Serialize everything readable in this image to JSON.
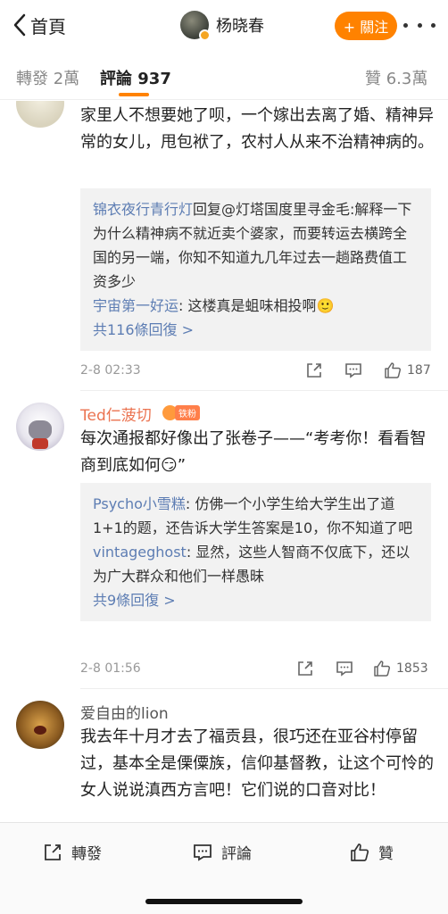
{
  "nav": {
    "back_label": "首頁",
    "user_name": "杨晓春",
    "follow_label": "+ 關注"
  },
  "tabs": [
    {
      "label": "轉發 2萬"
    },
    {
      "label": "評論 937"
    },
    {
      "label": "贊 6.3萬"
    }
  ],
  "comments": [
    {
      "user": "",
      "text": "家里人不想要她了呗，一个嫁出去离了婚、精神异常的女儿，甩包袱了，农村人从来不治精神病的。",
      "replies": [
        {
          "user": "锦衣夜行青行灯",
          "text": "回复@灯塔国度里寻金毛:解释一下为什么精神病不就近卖个婆家，而要转运去横跨全国的另一端，你知不知道九几年过去一趟路费值工资多少"
        },
        {
          "user": "宇宙第一好运",
          "text": ": 这楼真是蛆味相投啊🙂"
        }
      ],
      "more_replies": "共116條回復 >",
      "time": "2-8 02:33",
      "likes": "187"
    },
    {
      "user": "Ted仁菠切",
      "badge": "铁粉",
      "text": "每次通报都好像出了张卷子——“考考你！看看智商到底如何😏”",
      "replies": [
        {
          "user": "Psycho小雪糕",
          "text": ": 仿佛一个小学生给大学生出了道1+1的题，还告诉大学生答案是10，你不知道了吧"
        },
        {
          "user": "vintageghost",
          "text": ": 显然，这些人智商不仅底下，还以为广大群众和他们一样愚昧"
        }
      ],
      "more_replies": "共9條回復 >",
      "time": "2-8 01:56",
      "likes": "1853"
    },
    {
      "user": "爱自由的lion",
      "text": "我去年十月才去了福贡县，很巧还在亚谷村停留过，基本全是傈僳族，信仰基督教，让这个可怜的女人说说滇西方言吧！它们说的口音对比！"
    }
  ],
  "bottom": {
    "repost_label": "轉發",
    "comment_label": "評論",
    "like_label": "贊"
  },
  "colors": {
    "accent": "#ff8200",
    "username": "#eb7350",
    "link": "#5d7db3"
  }
}
